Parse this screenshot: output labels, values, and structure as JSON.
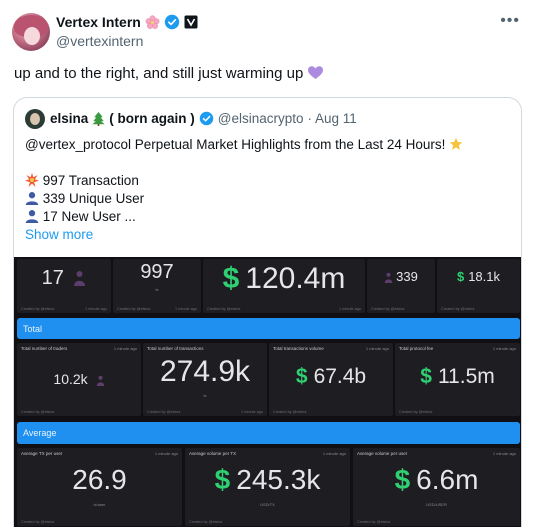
{
  "tweet": {
    "author_name": "Vertex Intern",
    "author_handle": "@vertexintern",
    "text": "up and to the right, and still just warming up"
  },
  "quote": {
    "author_name": "elsina",
    "author_suffix": "( born again )",
    "author_handle": "@elsinacrypto",
    "date": "· Aug 11",
    "line1": "@vertex_protocol Perpetual Market Highlights from the Last 24 Hours!",
    "line2": "997 Transaction",
    "line3": "339 Unique User",
    "line4": "17 New User ...",
    "show_more": "Show more"
  },
  "dashboard": {
    "top_row": {
      "new_users": "17",
      "transactions": "997",
      "transactions_unit": "tx",
      "volume": "120.4m",
      "unique_users": "339",
      "fees": "18.1k"
    },
    "total_label": "Total",
    "total": {
      "traders_title": "Total number of traders",
      "traders": "10.2k",
      "tx_title": "Total number of transactions",
      "tx": "274.9k",
      "tx_unit": "tx",
      "volume_title": "Total transactions volume",
      "volume": "67.4b",
      "fee_title": "Total protocol fee",
      "fee": "11.5m"
    },
    "average_label": "Average",
    "average": {
      "tx_per_user_title": "Average TX per user",
      "tx_per_user": "26.9",
      "tx_per_user_unit": "tx/user",
      "vol_per_tx_title": "Average volume per TX",
      "vol_per_tx": "245.3k",
      "vol_per_tx_unit": "USD/TX",
      "vol_per_user_title": "Average volume per user",
      "vol_per_user": "6.6m",
      "vol_per_user_unit": "USD/USER"
    },
    "status_text": "1 minute ago",
    "created_by": "Created by @elsina"
  },
  "colors": {
    "verified_blue": "#1d9bf0",
    "dollar_green": "#2fd072",
    "banner_blue": "#1f8ff0"
  },
  "icons": [
    "sakura-icon",
    "verified-badge-icon",
    "affiliate-badge-icon",
    "more-icon",
    "purple-heart-icon",
    "tree-icon",
    "star-icon",
    "collision-icon",
    "user-icon",
    "person-figure-icon"
  ]
}
